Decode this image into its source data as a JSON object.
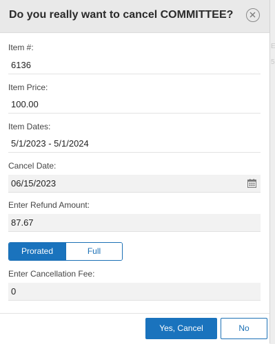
{
  "dialog": {
    "title": "Do you really want to cancel COMMITTEE?",
    "close_icon": "close-circle-icon"
  },
  "fields": {
    "item_number": {
      "label": "Item #:",
      "value": "6136"
    },
    "item_price": {
      "label": "Item Price:",
      "value": "100.00"
    },
    "item_dates": {
      "label": "Item Dates:",
      "value": "5/1/2023 - 5/1/2024"
    },
    "cancel_date": {
      "label": "Cancel Date:",
      "value": "06/15/2023",
      "icon": "calendar-icon"
    },
    "refund_amount": {
      "label": "Enter Refund Amount:",
      "value": "87.67"
    },
    "refund_type": {
      "options": [
        "Prorated",
        "Full"
      ],
      "selected": "Prorated"
    },
    "cancellation_fee": {
      "label": "Enter Cancellation Fee:",
      "value": "0"
    }
  },
  "footer": {
    "confirm_label": "Yes, Cancel",
    "decline_label": "No"
  },
  "background": {
    "fragments": [
      "E",
      "5"
    ]
  },
  "colors": {
    "accent": "#1a73bd",
    "header_bg": "#e9e9e9",
    "input_bg": "#f2f2f2"
  }
}
